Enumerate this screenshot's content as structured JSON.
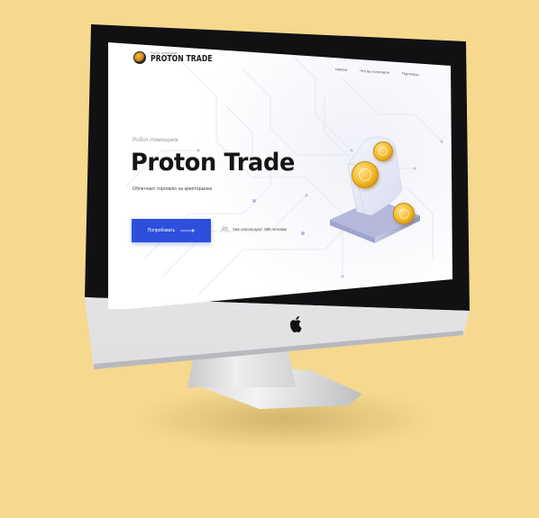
{
  "screen": {
    "brand": {
      "subtitle": "Робот-помощник",
      "name": "PROTON TRADE",
      "logo_icon": "coin-logo-icon"
    },
    "nav": [
      {
        "label": "совсем"
      },
      {
        "label": "Что вы получаете"
      },
      {
        "label": "Партнёры"
      }
    ],
    "hero": {
      "kicker": "Робот-помощник",
      "title": "Proton Trade",
      "description": "Облегчает торговлю на крипторынке",
      "cta_label": "Попробовать",
      "cta_icon": "arrow-right-icon",
      "users_icon": "users-icon",
      "users_text": "Уже используют: 589 человек"
    },
    "illustration": {
      "items": [
        "receipt-scroll",
        "gold-coin",
        "gold-coin",
        "gold-coin"
      ]
    }
  },
  "device": {
    "logo_icon": "apple-logo-icon"
  },
  "colors": {
    "background": "#f6d98f",
    "accent": "#2d4fdc",
    "coin": "#f3b623"
  }
}
